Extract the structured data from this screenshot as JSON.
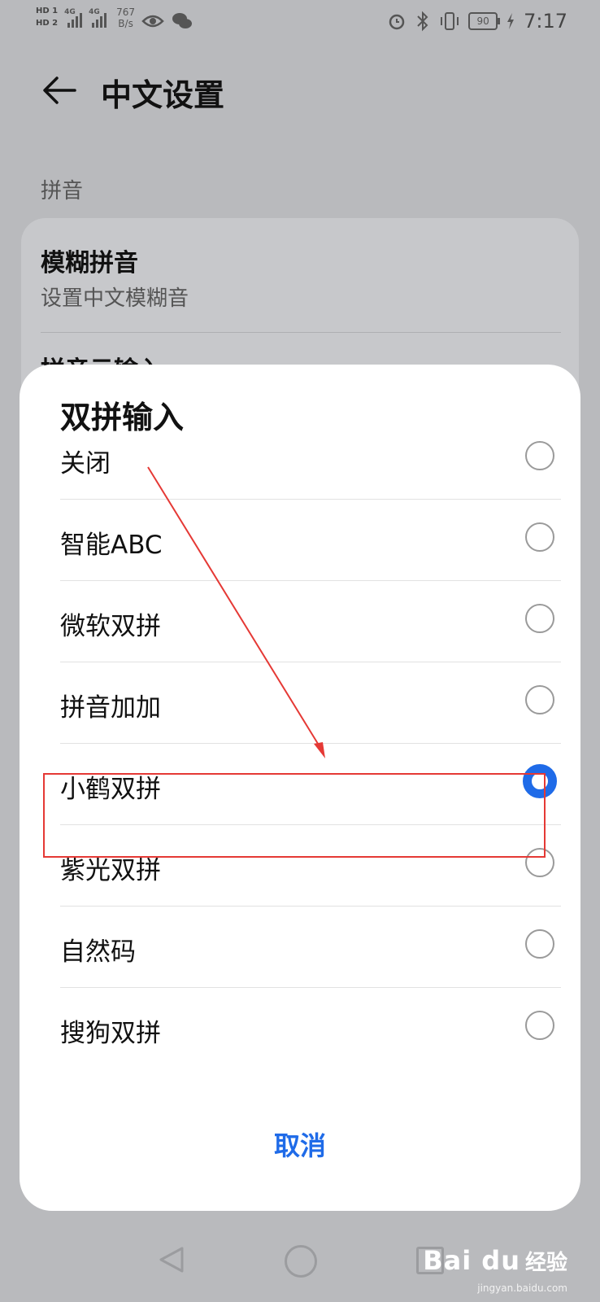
{
  "status_bar": {
    "sim1": "HD 1",
    "sim2": "HD 2",
    "net1": "4G",
    "net2": "4G",
    "speed_value": "767",
    "speed_unit": "B/s",
    "battery": "90",
    "time": "7:17",
    "icons": [
      "eye-icon",
      "wechat-icon",
      "alarm-icon",
      "bluetooth-icon",
      "vibrate-icon",
      "charging-icon"
    ]
  },
  "header": {
    "title": "中文设置"
  },
  "background": {
    "section_label": "拼音",
    "item1_title": "模糊拼音",
    "item1_sub": "设置中文模糊音",
    "item2_title": "拼音云输入"
  },
  "dialog": {
    "title": "双拼输入",
    "options": [
      {
        "label": "关闭",
        "checked": false
      },
      {
        "label": "智能ABC",
        "checked": false
      },
      {
        "label": "微软双拼",
        "checked": false
      },
      {
        "label": "拼音加加",
        "checked": false
      },
      {
        "label": "小鹤双拼",
        "checked": true
      },
      {
        "label": "紫光双拼",
        "checked": false
      },
      {
        "label": "自然码",
        "checked": false
      },
      {
        "label": "搜狗双拼",
        "checked": false
      }
    ],
    "cancel_label": "取消"
  },
  "colors": {
    "accent": "#1f6be8",
    "annotation": "#e53935",
    "scrim": "#b9babd"
  },
  "watermark": {
    "brand": "Bai du",
    "text": "经验",
    "url": "jingyan.baidu.com"
  }
}
